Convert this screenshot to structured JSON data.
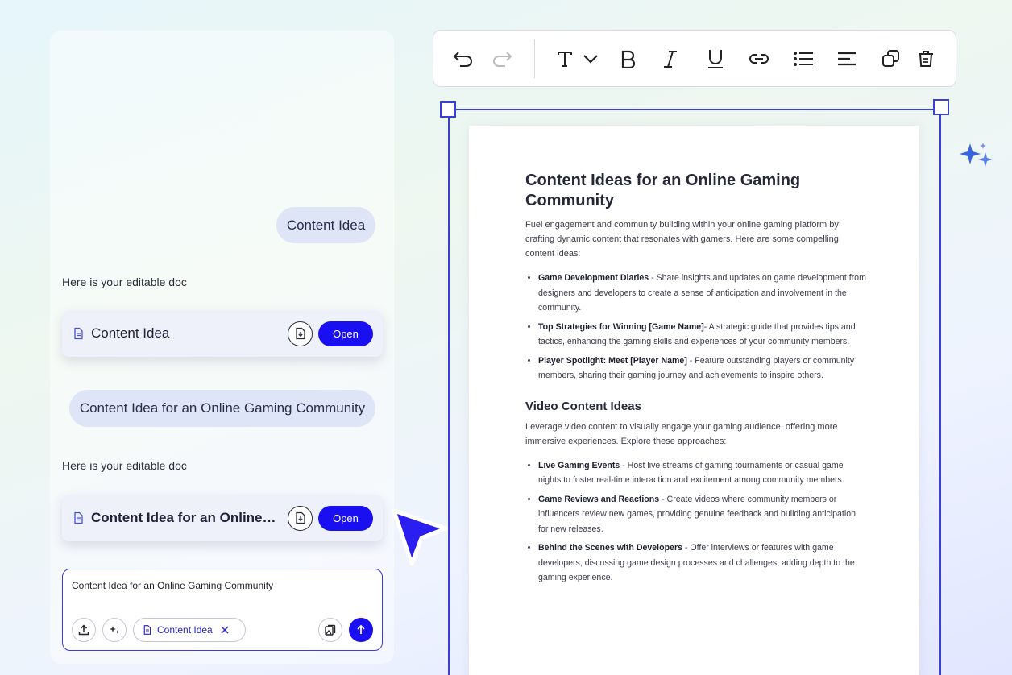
{
  "chat": {
    "user_message_1": "Content Idea",
    "bot_reply_1": "Here is your editable doc",
    "doc_card_1": {
      "title": "Content Idea",
      "open_label": "Open"
    },
    "user_message_2": "Content Idea for an Online Gaming Community",
    "bot_reply_2": "Here is your editable doc",
    "doc_card_2": {
      "title": "Content Idea for an Online Gaming Community",
      "open_label": "Open"
    },
    "composer": {
      "text": "Content Idea for an Online Gaming Community",
      "chip_label": "Content Idea"
    }
  },
  "toolbar": {
    "icons": [
      "undo-icon",
      "redo-icon",
      "text-style-icon",
      "chevron-down-icon",
      "bold-icon",
      "italic-icon",
      "underline-icon",
      "link-icon",
      "bullet-list-icon",
      "align-icon",
      "duplicate-icon",
      "delete-icon"
    ]
  },
  "document": {
    "title": "Content Ideas for an Online Gaming Community",
    "intro": "Fuel engagement and community building within your online gaming platform by crafting dynamic content that resonates with gamers. Here are some compelling content ideas:",
    "items_1": [
      {
        "bold": "Game Development Diaries",
        "text": " - Share insights and updates on game development from designers and developers to create a sense of anticipation and involvement in the community."
      },
      {
        "bold": "Top Strategies for Winning [Game Name]",
        "text": "- A strategic guide that provides tips and tactics, enhancing the gaming skills and experiences of your community members."
      },
      {
        "bold": "Player Spotlight: Meet [Player Name]",
        "text": " - Feature outstanding players or community members, sharing their gaming journey and achievements to inspire others."
      }
    ],
    "section_2_title": "Video Content Ideas",
    "section_2_intro": "Leverage video content to visually engage your gaming audience, offering more immersive experiences. Explore these approaches:",
    "items_2": [
      {
        "bold": "Live Gaming Events",
        "text": " - Host live streams of gaming tournaments or casual game nights to foster real-time interaction and excitement among community members."
      },
      {
        "bold": "Game Reviews and Reactions",
        "text": " - Create videos where community members or influencers review new games, providing genuine feedback and building anticipation for new releases."
      },
      {
        "bold": "Behind the Scenes with Developers",
        "text": " - Offer interviews or features with game developers, discussing game design processes and challenges, adding depth to the gaming experience."
      }
    ]
  },
  "colors": {
    "accent": "#1a0ff0",
    "selection": "#3a3fd8",
    "bubble": "#dde5f6"
  }
}
